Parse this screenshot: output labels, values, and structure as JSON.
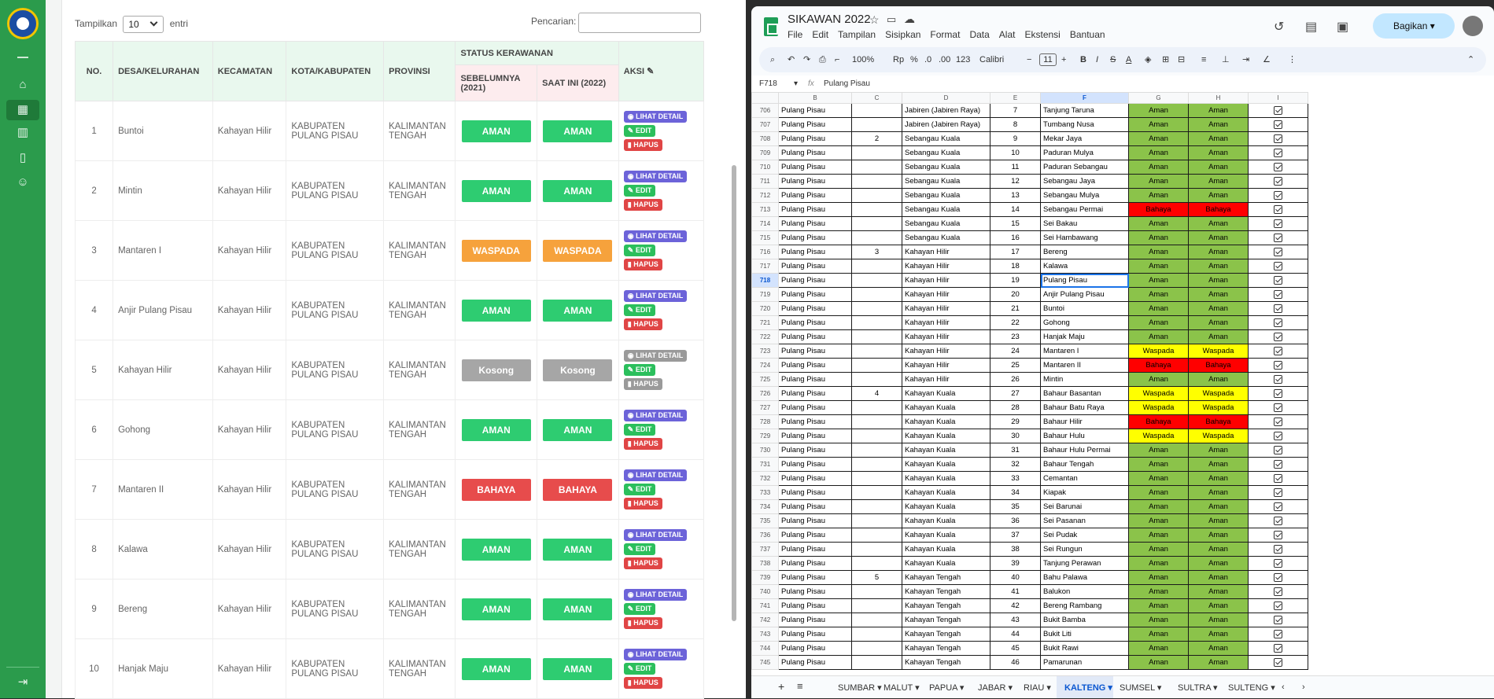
{
  "app": {
    "sidebar": {
      "icons": [
        "logo",
        "menu-dash",
        "home-icon",
        "map-icon",
        "building-icon",
        "book-icon",
        "users-icon",
        "logout-icon"
      ]
    },
    "length_control": {
      "prefix": "Tampilkan",
      "value": "10",
      "suffix": "entri"
    },
    "search": {
      "label": "Pencarian:",
      "value": ""
    },
    "headers": {
      "no": "NO.",
      "desa": "DESA/KELURAHAN",
      "kecamatan": "KECAMATAN",
      "kota": "KOTA/KABUPATEN",
      "provinsi": "PROVINSI",
      "status_group": "STATUS KERAWANAN",
      "sebelumnya": "SEBELUMNYA (2021)",
      "saat_ini": "SAAT INI (2022)",
      "aksi": "AKSI"
    },
    "action_labels": {
      "detail": "LIHAT DETAIL",
      "edit": "EDIT",
      "hapus": "HAPUS"
    },
    "rows": [
      {
        "no": "1",
        "desa": "Buntoi",
        "kecamatan": "Kahayan Hilir",
        "kota": "KABUPATEN PULANG PISAU",
        "provinsi": "KALIMANTAN TENGAH",
        "sebelumnya": "AMAN",
        "saat_ini": "AMAN"
      },
      {
        "no": "2",
        "desa": "Mintin",
        "kecamatan": "Kahayan Hilir",
        "kota": "KABUPATEN PULANG PISAU",
        "provinsi": "KALIMANTAN TENGAH",
        "sebelumnya": "AMAN",
        "saat_ini": "AMAN"
      },
      {
        "no": "3",
        "desa": "Mantaren I",
        "kecamatan": "Kahayan Hilir",
        "kota": "KABUPATEN PULANG PISAU",
        "provinsi": "KALIMANTAN TENGAH",
        "sebelumnya": "WASPADA",
        "saat_ini": "WASPADA"
      },
      {
        "no": "4",
        "desa": "Anjir Pulang Pisau",
        "kecamatan": "Kahayan Hilir",
        "kota": "KABUPATEN PULANG PISAU",
        "provinsi": "KALIMANTAN TENGAH",
        "sebelumnya": "AMAN",
        "saat_ini": "AMAN"
      },
      {
        "no": "5",
        "desa": "Kahayan Hilir",
        "kecamatan": "Kahayan Hilir",
        "kota": "KABUPATEN PULANG PISAU",
        "provinsi": "KALIMANTAN TENGAH",
        "sebelumnya": "Kosong",
        "saat_ini": "Kosong"
      },
      {
        "no": "6",
        "desa": "Gohong",
        "kecamatan": "Kahayan Hilir",
        "kota": "KABUPATEN PULANG PISAU",
        "provinsi": "KALIMANTAN TENGAH",
        "sebelumnya": "AMAN",
        "saat_ini": "AMAN"
      },
      {
        "no": "7",
        "desa": "Mantaren II",
        "kecamatan": "Kahayan Hilir",
        "kota": "KABUPATEN PULANG PISAU",
        "provinsi": "KALIMANTAN TENGAH",
        "sebelumnya": "BAHAYA",
        "saat_ini": "BAHAYA"
      },
      {
        "no": "8",
        "desa": "Kalawa",
        "kecamatan": "Kahayan Hilir",
        "kota": "KABUPATEN PULANG PISAU",
        "provinsi": "KALIMANTAN TENGAH",
        "sebelumnya": "AMAN",
        "saat_ini": "AMAN"
      },
      {
        "no": "9",
        "desa": "Bereng",
        "kecamatan": "Kahayan Hilir",
        "kota": "KABUPATEN PULANG PISAU",
        "provinsi": "KALIMANTAN TENGAH",
        "sebelumnya": "AMAN",
        "saat_ini": "AMAN"
      },
      {
        "no": "10",
        "desa": "Hanjak Maju",
        "kecamatan": "Kahayan Hilir",
        "kota": "KABUPATEN PULANG PISAU",
        "provinsi": "KALIMANTAN TENGAH",
        "sebelumnya": "AMAN",
        "saat_ini": "AMAN"
      }
    ],
    "colors": {
      "sidebar": "#2b9b4c",
      "aman": "#2ecc71",
      "waspada": "#f6a23c",
      "bahaya": "#e74c4c",
      "kosong": "#a6a6a6",
      "detail": "#6c63d9",
      "edit": "#2bbf5c",
      "hapus": "#e04545"
    }
  },
  "sheets": {
    "title": "SIKAWAN 2022",
    "menu": [
      "File",
      "Edit",
      "Tampilan",
      "Sisipkan",
      "Format",
      "Data",
      "Alat",
      "Ekstensi",
      "Bantuan"
    ],
    "share_label": "Bagikan",
    "toolbar": {
      "zoom": "100%",
      "currency": "Rp",
      "percent": "%",
      "dec_dec": ".0",
      "dec_inc": ".00",
      "num_format": "123",
      "font": "Calibri",
      "font_size": "11"
    },
    "name_box": "F718",
    "formula": "Pulang Pisau",
    "columns": [
      "B",
      "C",
      "D",
      "E",
      "F",
      "G",
      "H",
      "I"
    ],
    "selected_column": "F",
    "selected_row": "718",
    "rows": [
      {
        "r": "706",
        "b": "Pulang Pisau",
        "c": "",
        "d": "Jabiren (Jabiren Raya)",
        "e": "7",
        "f": "Tanjung Taruna",
        "g": "Aman",
        "h": "Aman"
      },
      {
        "r": "707",
        "b": "Pulang Pisau",
        "c": "",
        "d": "Jabiren (Jabiren Raya)",
        "e": "8",
        "f": "Tumbang Nusa",
        "g": "Aman",
        "h": "Aman"
      },
      {
        "r": "708",
        "b": "Pulang Pisau",
        "c": "2",
        "d": "Sebangau Kuala",
        "e": "9",
        "f": "Mekar Jaya",
        "g": "Aman",
        "h": "Aman"
      },
      {
        "r": "709",
        "b": "Pulang Pisau",
        "c": "",
        "d": "Sebangau Kuala",
        "e": "10",
        "f": "Paduran Mulya",
        "g": "Aman",
        "h": "Aman"
      },
      {
        "r": "710",
        "b": "Pulang Pisau",
        "c": "",
        "d": "Sebangau Kuala",
        "e": "11",
        "f": "Paduran Sebangau",
        "g": "Aman",
        "h": "Aman"
      },
      {
        "r": "711",
        "b": "Pulang Pisau",
        "c": "",
        "d": "Sebangau Kuala",
        "e": "12",
        "f": "Sebangau Jaya",
        "g": "Aman",
        "h": "Aman"
      },
      {
        "r": "712",
        "b": "Pulang Pisau",
        "c": "",
        "d": "Sebangau Kuala",
        "e": "13",
        "f": "Sebangau Mulya",
        "g": "Aman",
        "h": "Aman"
      },
      {
        "r": "713",
        "b": "Pulang Pisau",
        "c": "",
        "d": "Sebangau Kuala",
        "e": "14",
        "f": "Sebangau Permai",
        "g": "Bahaya",
        "h": "Bahaya"
      },
      {
        "r": "714",
        "b": "Pulang Pisau",
        "c": "",
        "d": "Sebangau Kuala",
        "e": "15",
        "f": "Sei Bakau",
        "g": "Aman",
        "h": "Aman"
      },
      {
        "r": "715",
        "b": "Pulang Pisau",
        "c": "",
        "d": "Sebangau Kuala",
        "e": "16",
        "f": "Sei Hambawang",
        "g": "Aman",
        "h": "Aman"
      },
      {
        "r": "716",
        "b": "Pulang Pisau",
        "c": "3",
        "d": "Kahayan Hilir",
        "e": "17",
        "f": "Bereng",
        "g": "Aman",
        "h": "Aman"
      },
      {
        "r": "717",
        "b": "Pulang Pisau",
        "c": "",
        "d": "Kahayan Hilir",
        "e": "18",
        "f": "Kalawa",
        "g": "Aman",
        "h": "Aman"
      },
      {
        "r": "718",
        "b": "Pulang Pisau",
        "c": "",
        "d": "Kahayan Hilir",
        "e": "19",
        "f": "Pulang Pisau",
        "g": "Aman",
        "h": "Aman"
      },
      {
        "r": "719",
        "b": "Pulang Pisau",
        "c": "",
        "d": "Kahayan Hilir",
        "e": "20",
        "f": "Anjir Pulang Pisau",
        "g": "Aman",
        "h": "Aman"
      },
      {
        "r": "720",
        "b": "Pulang Pisau",
        "c": "",
        "d": "Kahayan Hilir",
        "e": "21",
        "f": "Buntoi",
        "g": "Aman",
        "h": "Aman"
      },
      {
        "r": "721",
        "b": "Pulang Pisau",
        "c": "",
        "d": "Kahayan Hilir",
        "e": "22",
        "f": "Gohong",
        "g": "Aman",
        "h": "Aman"
      },
      {
        "r": "722",
        "b": "Pulang Pisau",
        "c": "",
        "d": "Kahayan Hilir",
        "e": "23",
        "f": "Hanjak Maju",
        "g": "Aman",
        "h": "Aman"
      },
      {
        "r": "723",
        "b": "Pulang Pisau",
        "c": "",
        "d": "Kahayan Hilir",
        "e": "24",
        "f": "Mantaren I",
        "g": "Waspada",
        "h": "Waspada"
      },
      {
        "r": "724",
        "b": "Pulang Pisau",
        "c": "",
        "d": "Kahayan Hilir",
        "e": "25",
        "f": "Mantaren II",
        "g": "Bahaya",
        "h": "Bahaya"
      },
      {
        "r": "725",
        "b": "Pulang Pisau",
        "c": "",
        "d": "Kahayan Hilir",
        "e": "26",
        "f": "Mintin",
        "g": "Aman",
        "h": "Aman"
      },
      {
        "r": "726",
        "b": "Pulang Pisau",
        "c": "4",
        "d": "Kahayan Kuala",
        "e": "27",
        "f": "Bahaur Basantan",
        "g": "Waspada",
        "h": "Waspada"
      },
      {
        "r": "727",
        "b": "Pulang Pisau",
        "c": "",
        "d": "Kahayan Kuala",
        "e": "28",
        "f": "Bahaur Batu Raya",
        "g": "Waspada",
        "h": "Waspada"
      },
      {
        "r": "728",
        "b": "Pulang Pisau",
        "c": "",
        "d": "Kahayan Kuala",
        "e": "29",
        "f": "Bahaur Hilir",
        "g": "Bahaya",
        "h": "Bahaya"
      },
      {
        "r": "729",
        "b": "Pulang Pisau",
        "c": "",
        "d": "Kahayan Kuala",
        "e": "30",
        "f": "Bahaur Hulu",
        "g": "Waspada",
        "h": "Waspada"
      },
      {
        "r": "730",
        "b": "Pulang Pisau",
        "c": "",
        "d": "Kahayan Kuala",
        "e": "31",
        "f": "Bahaur Hulu Permai",
        "g": "Aman",
        "h": "Aman"
      },
      {
        "r": "731",
        "b": "Pulang Pisau",
        "c": "",
        "d": "Kahayan Kuala",
        "e": "32",
        "f": "Bahaur Tengah",
        "g": "Aman",
        "h": "Aman"
      },
      {
        "r": "732",
        "b": "Pulang Pisau",
        "c": "",
        "d": "Kahayan Kuala",
        "e": "33",
        "f": "Cemantan",
        "g": "Aman",
        "h": "Aman"
      },
      {
        "r": "733",
        "b": "Pulang Pisau",
        "c": "",
        "d": "Kahayan Kuala",
        "e": "34",
        "f": "Kiapak",
        "g": "Aman",
        "h": "Aman"
      },
      {
        "r": "734",
        "b": "Pulang Pisau",
        "c": "",
        "d": "Kahayan Kuala",
        "e": "35",
        "f": "Sei Barunai",
        "g": "Aman",
        "h": "Aman"
      },
      {
        "r": "735",
        "b": "Pulang Pisau",
        "c": "",
        "d": "Kahayan Kuala",
        "e": "36",
        "f": "Sei Pasanan",
        "g": "Aman",
        "h": "Aman"
      },
      {
        "r": "736",
        "b": "Pulang Pisau",
        "c": "",
        "d": "Kahayan Kuala",
        "e": "37",
        "f": "Sei Pudak",
        "g": "Aman",
        "h": "Aman"
      },
      {
        "r": "737",
        "b": "Pulang Pisau",
        "c": "",
        "d": "Kahayan Kuala",
        "e": "38",
        "f": "Sei Rungun",
        "g": "Aman",
        "h": "Aman"
      },
      {
        "r": "738",
        "b": "Pulang Pisau",
        "c": "",
        "d": "Kahayan Kuala",
        "e": "39",
        "f": "Tanjung Perawan",
        "g": "Aman",
        "h": "Aman"
      },
      {
        "r": "739",
        "b": "Pulang Pisau",
        "c": "5",
        "d": "Kahayan Tengah",
        "e": "40",
        "f": "Bahu Palawa",
        "g": "Aman",
        "h": "Aman"
      },
      {
        "r": "740",
        "b": "Pulang Pisau",
        "c": "",
        "d": "Kahayan Tengah",
        "e": "41",
        "f": "Balukon",
        "g": "Aman",
        "h": "Aman"
      },
      {
        "r": "741",
        "b": "Pulang Pisau",
        "c": "",
        "d": "Kahayan Tengah",
        "e": "42",
        "f": "Bereng Rambang",
        "g": "Aman",
        "h": "Aman"
      },
      {
        "r": "742",
        "b": "Pulang Pisau",
        "c": "",
        "d": "Kahayan Tengah",
        "e": "43",
        "f": "Bukit Bamba",
        "g": "Aman",
        "h": "Aman"
      },
      {
        "r": "743",
        "b": "Pulang Pisau",
        "c": "",
        "d": "Kahayan Tengah",
        "e": "44",
        "f": "Bukit Liti",
        "g": "Aman",
        "h": "Aman"
      },
      {
        "r": "744",
        "b": "Pulang Pisau",
        "c": "",
        "d": "Kahayan Tengah",
        "e": "45",
        "f": "Bukit Rawi",
        "g": "Aman",
        "h": "Aman"
      },
      {
        "r": "745",
        "b": "Pulang Pisau",
        "c": "",
        "d": "Kahayan Tengah",
        "e": "46",
        "f": "Pamarunan",
        "g": "Aman",
        "h": "Aman"
      }
    ],
    "tabs": [
      "SUMBAR",
      "MALUT",
      "PAPUA",
      "JABAR",
      "RIAU",
      "KALTENG",
      "SUMSEL",
      "SULTRA",
      "SULTENG"
    ],
    "active_tab": "KALTENG",
    "colors": {
      "aman": "#8bc34a",
      "waspada": "#ffff00",
      "bahaya": "#ff0000"
    }
  }
}
